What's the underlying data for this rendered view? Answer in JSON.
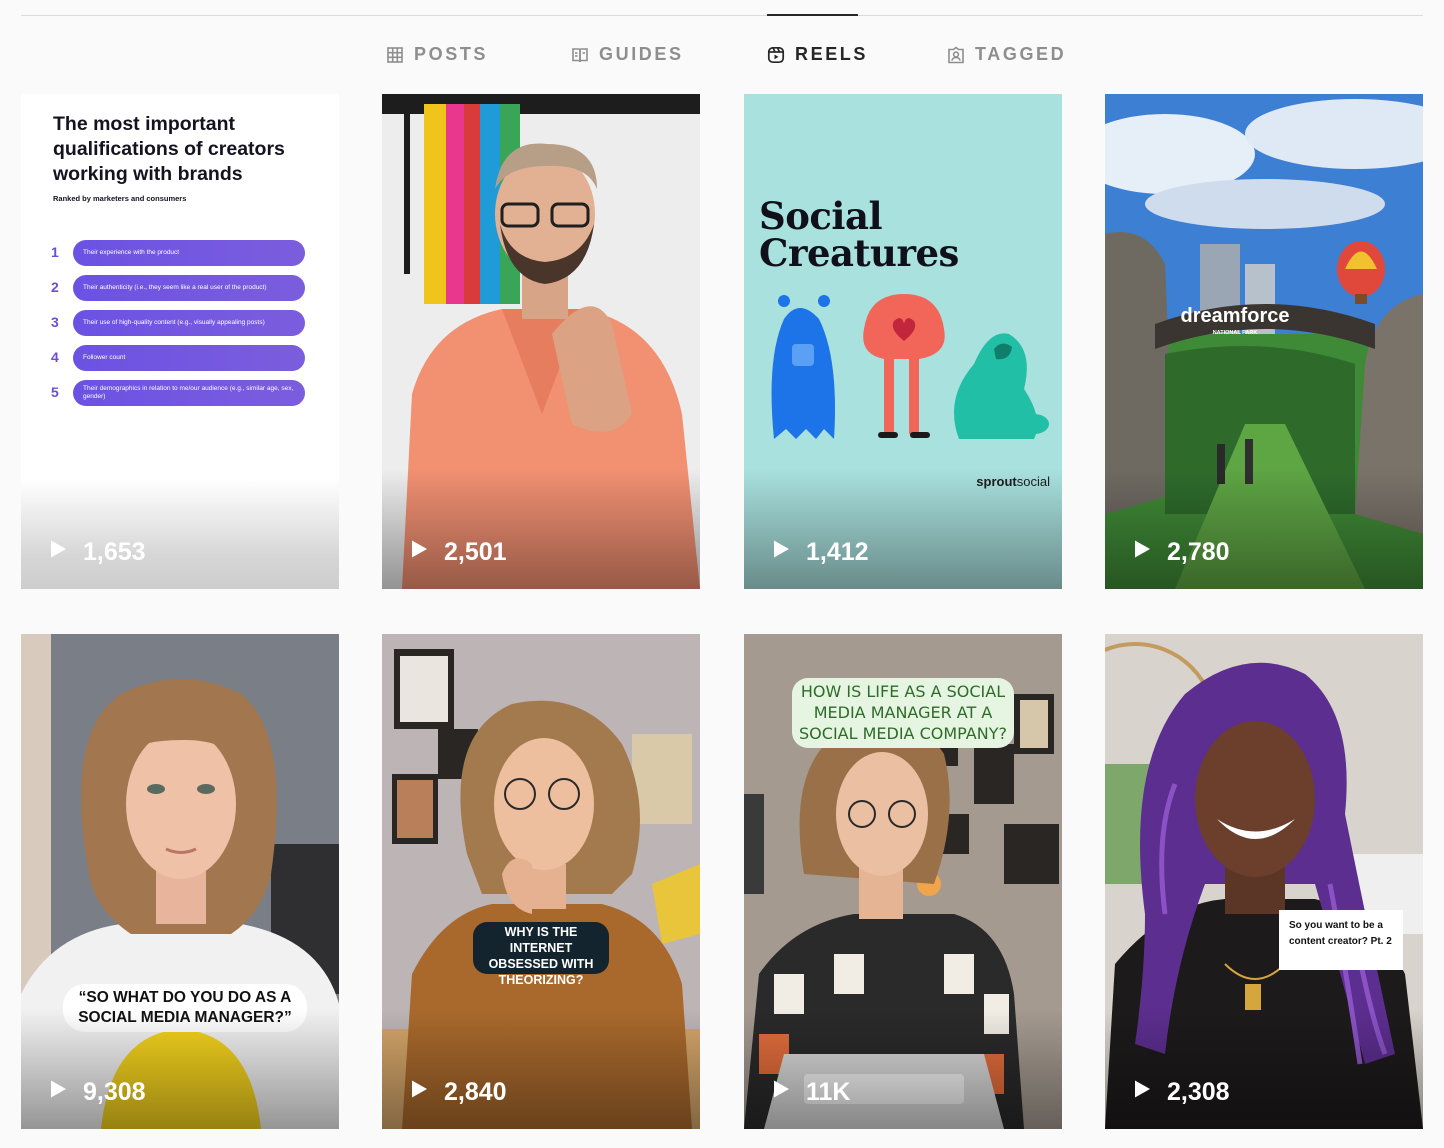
{
  "tabs": [
    {
      "label": "POSTS",
      "icon": "grid-icon"
    },
    {
      "label": "GUIDES",
      "icon": "guide-icon"
    },
    {
      "label": "REELS",
      "icon": "reels-icon",
      "active": true
    },
    {
      "label": "TAGGED",
      "icon": "tagged-icon"
    }
  ],
  "reels": [
    {
      "views": "1,653",
      "title": "The most important qualifications of creators working with brands",
      "subtitle": "Ranked by marketers and consumers",
      "ranks": [
        {
          "num": "1",
          "text": "Their experience with the product"
        },
        {
          "num": "2",
          "text": "Their authenticity (i.e., they seem like a real user of the product)"
        },
        {
          "num": "3",
          "text": "Their use of high-quality content (e.g., visually appealing posts)"
        },
        {
          "num": "4",
          "text": "Follower count"
        },
        {
          "num": "5",
          "text": "Their demographics in relation to me/our audience (e.g., similar age, sex, gender)"
        }
      ]
    },
    {
      "views": "2,501"
    },
    {
      "views": "1,412",
      "title_line1": "Social",
      "title_line2": "Creatures",
      "brand_bold": "sprout",
      "brand_rest": "social"
    },
    {
      "views": "2,780",
      "sign_title": "dreamforce",
      "sign_sub": "NATIONAL PARK"
    },
    {
      "views": "9,308",
      "caption": "“SO WHAT DO YOU DO AS A SOCIAL MEDIA MANAGER?”"
    },
    {
      "views": "2,840",
      "caption": "WHY IS THE INTERNET OBSESSED WITH THEORIZING?"
    },
    {
      "views": "11K",
      "caption": "HOW IS LIFE AS A SOCIAL MEDIA MANAGER AT A SOCIAL MEDIA COMPANY?"
    },
    {
      "views": "2,308",
      "caption": "So you want to be a content creator? Pt. 2"
    }
  ],
  "colors": {
    "accent": "#262626",
    "muted": "#8e8e8e",
    "rank_purple": "#6c52e4",
    "teal": "#a8e1de"
  }
}
